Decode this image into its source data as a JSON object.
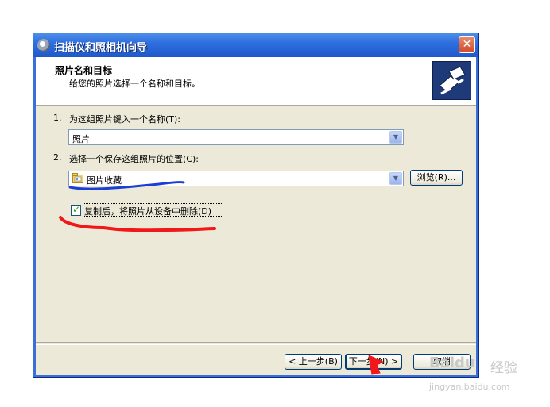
{
  "window": {
    "title": "扫描仪和照相机向导",
    "close_glyph": "✕"
  },
  "header": {
    "title": "照片名和目标",
    "subtitle": "给您的照片选择一个名称和目标。",
    "icon": "camera-wizard-icon"
  },
  "step1": {
    "number": "1.",
    "label": "为这组照片键入一个名称(T):",
    "name_value": "照片"
  },
  "step2": {
    "number": "2.",
    "label": "选择一个保存这组照片的位置(C):",
    "location_value": "图片收藏",
    "browse_label": "浏览(R)..."
  },
  "delete_after_copy": {
    "label": "复制后，将照片从设备中删除(D)",
    "checked": true
  },
  "footer": {
    "back_label": "< 上一步(B)",
    "next_label": "下一步(N) >",
    "cancel_label": "取消"
  },
  "watermark": {
    "brand": "Baidu",
    "brand_suffix": "经验",
    "url": "jingyan.baidu.com"
  },
  "colors": {
    "title_bar": "#2f6fe0",
    "client_bg": "#ece9d8",
    "blue_annotation": "#1a3fd6",
    "red_annotation": "#f01818"
  }
}
